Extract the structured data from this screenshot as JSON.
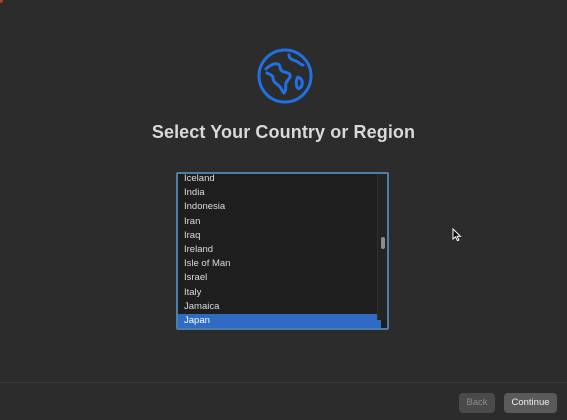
{
  "title": "Select Your Country or Region",
  "countries": {
    "items": [
      "Iceland",
      "India",
      "Indonesia",
      "Iran",
      "Iraq",
      "Ireland",
      "Isle of Man",
      "Israel",
      "Italy",
      "Jamaica",
      "Japan"
    ],
    "selected": "Japan"
  },
  "buttons": {
    "back": "Back",
    "continue": "Continue"
  },
  "colors": {
    "accent": "#2f6bc4",
    "globe": "#1f72e6",
    "background": "#2c2c2c"
  }
}
